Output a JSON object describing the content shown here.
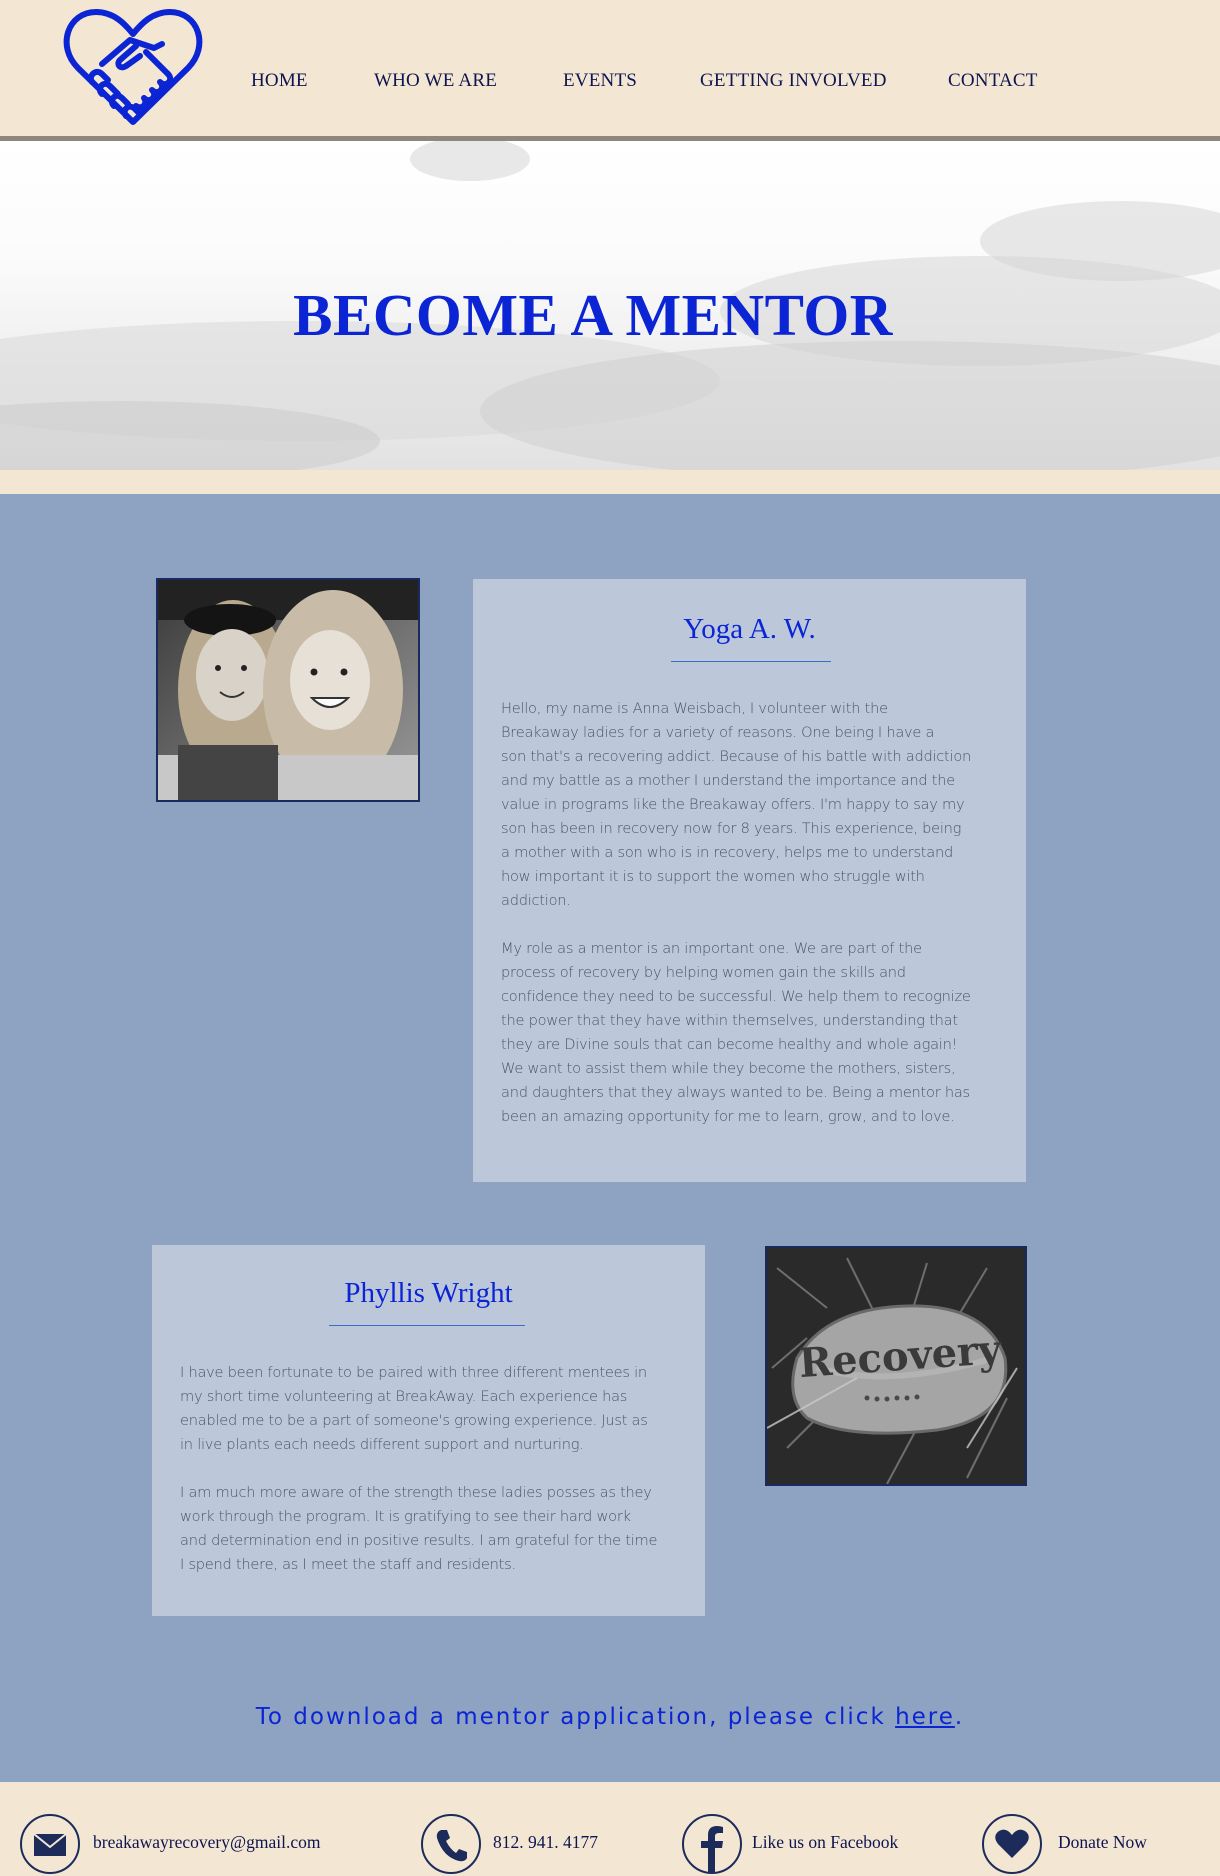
{
  "header": {
    "logo_name": "heart-handshake-logo",
    "nav": [
      "HOME",
      "WHO WE ARE",
      "EVENTS",
      "GETTING INVOLVED",
      "CONTACT"
    ]
  },
  "hero": {
    "title": "BECOME A MENTOR"
  },
  "mentors": [
    {
      "name": "Yoga A. W.",
      "photo": "selfie-two-women-photo",
      "paragraphs": [
        [
          "Hello, my name is Anna Weisbach, I volunteer with the",
          "Breakaway ladies for a variety of reasons. One being I have a",
          "son that's a recovering addict. Because of his battle with addiction",
          "and my battle as a mother I understand the importance and the",
          "value in programs like the Breakaway offers. I'm happy to say my",
          "son has been in recovery now for 8 years. This experience, being",
          "a mother with a son who is in recovery, helps me to understand",
          "how important it is to support the women who struggle with",
          "addiction."
        ],
        [
          "My role as a mentor is an important one. We are part of the",
          "process of recovery by helping women gain the skills and",
          "confidence they need to be successful. We help them to recognize",
          "the power that they have within themselves, understanding that",
          "they are Divine souls that can become healthy and whole again!",
          "We want to assist them while they become the mothers, sisters,",
          "and daughters that they always wanted to be. Being a mentor has",
          "been an amazing opportunity for me to learn, grow, and to love."
        ]
      ]
    },
    {
      "name": "Phyllis Wright",
      "photo": "recovery-rock-photo",
      "rock_text": "Recovery",
      "paragraphs": [
        [
          "I have been fortunate to be paired with three different mentees in",
          "my short time volunteering at BreakAway. Each experience has",
          "enabled me to be a part of someone's growing experience. Just as",
          "in live plants each needs different support and nurturing."
        ],
        [
          "I am much more aware of the strength these ladies posses as they",
          "work through the program. It is gratifying to see their hard work",
          "and determination end in positive results. I am grateful for the time",
          "I spend there, as I meet the staff and residents."
        ]
      ]
    }
  ],
  "download": {
    "prefix": "To download a mentor application, please click ",
    "link": "here",
    "suffix": "."
  },
  "footer": [
    {
      "icon": "envelope-icon",
      "text": "breakawayrecovery@gmail.com"
    },
    {
      "icon": "phone-icon",
      "text": "812. 941. 4177"
    },
    {
      "icon": "facebook-icon",
      "text": "Like us on Facebook"
    },
    {
      "icon": "heart-icon",
      "text": "Donate Now"
    }
  ],
  "colors": {
    "header_bg": "#f3e7d3",
    "main_bg": "#8ea3c1",
    "card_bg": "#bcc8da",
    "accent_blue": "#0b24d4",
    "nav_text": "#0e1450"
  }
}
